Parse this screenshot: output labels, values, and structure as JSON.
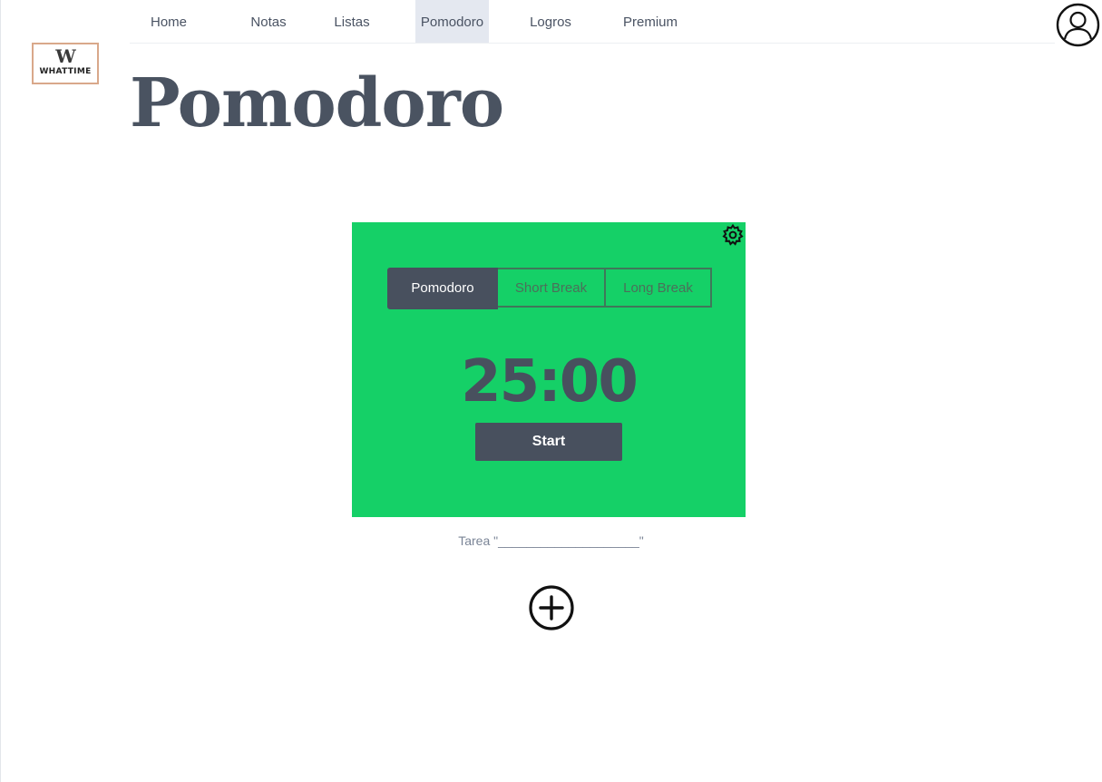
{
  "nav": {
    "items": [
      {
        "label": "Home"
      },
      {
        "label": "Notas"
      },
      {
        "label": "Listas"
      },
      {
        "label": "Pomodoro",
        "active": true
      },
      {
        "label": "Logros"
      },
      {
        "label": "Premium"
      }
    ]
  },
  "logo": {
    "mark": "W",
    "text": "WHATTIME"
  },
  "page": {
    "title": "Pomodoro"
  },
  "timer": {
    "modes": [
      {
        "label": "Pomodoro",
        "active": true
      },
      {
        "label": "Short Break"
      },
      {
        "label": "Long Break"
      }
    ],
    "display": "25:00",
    "start_label": "Start",
    "background_color": "#15d067"
  },
  "task": {
    "text": "Tarea \"____________________\""
  },
  "icons": {
    "avatar": "user-circle-icon",
    "settings": "gear-icon",
    "add": "plus-circle-icon"
  },
  "colors": {
    "accent_dark": "#48505e",
    "timer_green": "#15d067",
    "nav_active_bg": "#e4e8f0"
  }
}
